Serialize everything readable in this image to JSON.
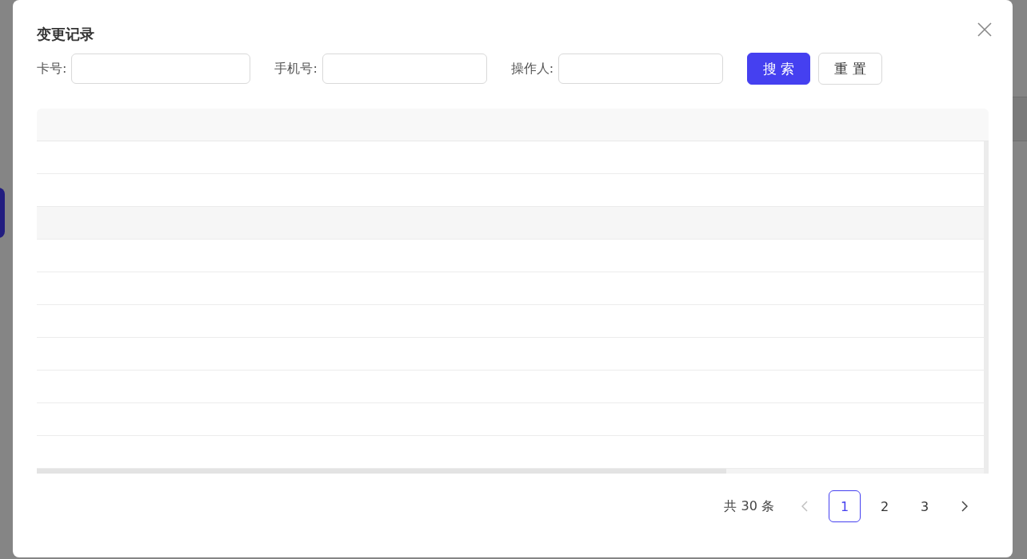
{
  "dialog": {
    "title": "变更记录"
  },
  "filters": [
    {
      "label": "卡号:"
    },
    {
      "label": "手机号:"
    },
    {
      "label": "操作人:"
    }
  ],
  "buttons": [
    {
      "label": "搜 索",
      "kind": "primary"
    },
    {
      "label": "重 置",
      "kind": "default"
    }
  ],
  "table": {
    "rows": [
      {
        "kind": "header"
      },
      {
        "kind": "plain"
      },
      {
        "kind": "plain"
      },
      {
        "kind": "shaded"
      },
      {
        "kind": "plain"
      },
      {
        "kind": "plain"
      },
      {
        "kind": "plain"
      },
      {
        "kind": "plain"
      },
      {
        "kind": "plain"
      },
      {
        "kind": "plain"
      },
      {
        "kind": "plain"
      }
    ]
  },
  "pagination": {
    "total": "共 30 条",
    "prev": {
      "disabled": true
    },
    "pages": [
      {
        "label": "1",
        "selected": true
      },
      {
        "label": "2",
        "selected": false
      },
      {
        "label": "3",
        "selected": false
      }
    ],
    "next": {
      "disabled": false
    }
  }
}
